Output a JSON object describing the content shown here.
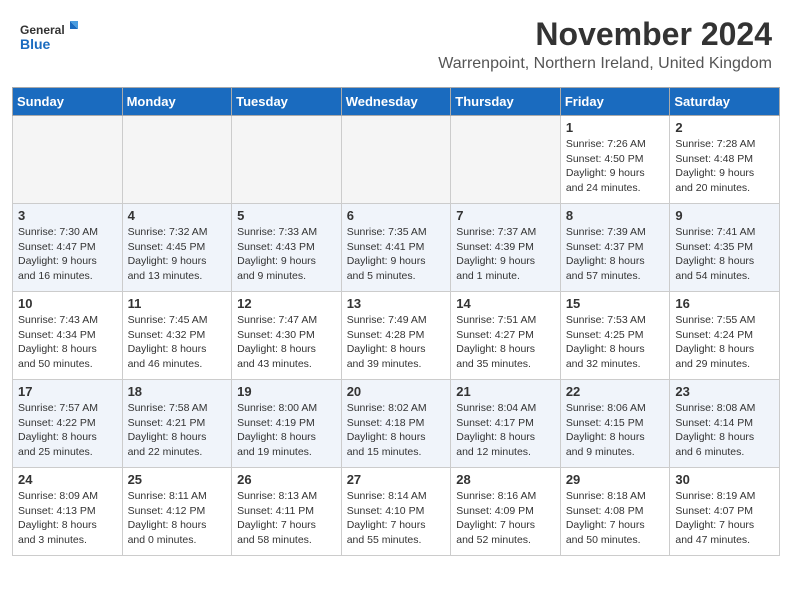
{
  "header": {
    "logo_general": "General",
    "logo_blue": "Blue",
    "title": "November 2024",
    "location": "Warrenpoint, Northern Ireland, United Kingdom"
  },
  "days_of_week": [
    "Sunday",
    "Monday",
    "Tuesday",
    "Wednesday",
    "Thursday",
    "Friday",
    "Saturday"
  ],
  "weeks": [
    [
      {
        "day": "",
        "empty": true
      },
      {
        "day": "",
        "empty": true
      },
      {
        "day": "",
        "empty": true
      },
      {
        "day": "",
        "empty": true
      },
      {
        "day": "",
        "empty": true
      },
      {
        "day": "1",
        "sunrise": "Sunrise: 7:26 AM",
        "sunset": "Sunset: 4:50 PM",
        "daylight": "Daylight: 9 hours and 24 minutes."
      },
      {
        "day": "2",
        "sunrise": "Sunrise: 7:28 AM",
        "sunset": "Sunset: 4:48 PM",
        "daylight": "Daylight: 9 hours and 20 minutes."
      }
    ],
    [
      {
        "day": "3",
        "sunrise": "Sunrise: 7:30 AM",
        "sunset": "Sunset: 4:47 PM",
        "daylight": "Daylight: 9 hours and 16 minutes."
      },
      {
        "day": "4",
        "sunrise": "Sunrise: 7:32 AM",
        "sunset": "Sunset: 4:45 PM",
        "daylight": "Daylight: 9 hours and 13 minutes."
      },
      {
        "day": "5",
        "sunrise": "Sunrise: 7:33 AM",
        "sunset": "Sunset: 4:43 PM",
        "daylight": "Daylight: 9 hours and 9 minutes."
      },
      {
        "day": "6",
        "sunrise": "Sunrise: 7:35 AM",
        "sunset": "Sunset: 4:41 PM",
        "daylight": "Daylight: 9 hours and 5 minutes."
      },
      {
        "day": "7",
        "sunrise": "Sunrise: 7:37 AM",
        "sunset": "Sunset: 4:39 PM",
        "daylight": "Daylight: 9 hours and 1 minute."
      },
      {
        "day": "8",
        "sunrise": "Sunrise: 7:39 AM",
        "sunset": "Sunset: 4:37 PM",
        "daylight": "Daylight: 8 hours and 57 minutes."
      },
      {
        "day": "9",
        "sunrise": "Sunrise: 7:41 AM",
        "sunset": "Sunset: 4:35 PM",
        "daylight": "Daylight: 8 hours and 54 minutes."
      }
    ],
    [
      {
        "day": "10",
        "sunrise": "Sunrise: 7:43 AM",
        "sunset": "Sunset: 4:34 PM",
        "daylight": "Daylight: 8 hours and 50 minutes."
      },
      {
        "day": "11",
        "sunrise": "Sunrise: 7:45 AM",
        "sunset": "Sunset: 4:32 PM",
        "daylight": "Daylight: 8 hours and 46 minutes."
      },
      {
        "day": "12",
        "sunrise": "Sunrise: 7:47 AM",
        "sunset": "Sunset: 4:30 PM",
        "daylight": "Daylight: 8 hours and 43 minutes."
      },
      {
        "day": "13",
        "sunrise": "Sunrise: 7:49 AM",
        "sunset": "Sunset: 4:28 PM",
        "daylight": "Daylight: 8 hours and 39 minutes."
      },
      {
        "day": "14",
        "sunrise": "Sunrise: 7:51 AM",
        "sunset": "Sunset: 4:27 PM",
        "daylight": "Daylight: 8 hours and 35 minutes."
      },
      {
        "day": "15",
        "sunrise": "Sunrise: 7:53 AM",
        "sunset": "Sunset: 4:25 PM",
        "daylight": "Daylight: 8 hours and 32 minutes."
      },
      {
        "day": "16",
        "sunrise": "Sunrise: 7:55 AM",
        "sunset": "Sunset: 4:24 PM",
        "daylight": "Daylight: 8 hours and 29 minutes."
      }
    ],
    [
      {
        "day": "17",
        "sunrise": "Sunrise: 7:57 AM",
        "sunset": "Sunset: 4:22 PM",
        "daylight": "Daylight: 8 hours and 25 minutes."
      },
      {
        "day": "18",
        "sunrise": "Sunrise: 7:58 AM",
        "sunset": "Sunset: 4:21 PM",
        "daylight": "Daylight: 8 hours and 22 minutes."
      },
      {
        "day": "19",
        "sunrise": "Sunrise: 8:00 AM",
        "sunset": "Sunset: 4:19 PM",
        "daylight": "Daylight: 8 hours and 19 minutes."
      },
      {
        "day": "20",
        "sunrise": "Sunrise: 8:02 AM",
        "sunset": "Sunset: 4:18 PM",
        "daylight": "Daylight: 8 hours and 15 minutes."
      },
      {
        "day": "21",
        "sunrise": "Sunrise: 8:04 AM",
        "sunset": "Sunset: 4:17 PM",
        "daylight": "Daylight: 8 hours and 12 minutes."
      },
      {
        "day": "22",
        "sunrise": "Sunrise: 8:06 AM",
        "sunset": "Sunset: 4:15 PM",
        "daylight": "Daylight: 8 hours and 9 minutes."
      },
      {
        "day": "23",
        "sunrise": "Sunrise: 8:08 AM",
        "sunset": "Sunset: 4:14 PM",
        "daylight": "Daylight: 8 hours and 6 minutes."
      }
    ],
    [
      {
        "day": "24",
        "sunrise": "Sunrise: 8:09 AM",
        "sunset": "Sunset: 4:13 PM",
        "daylight": "Daylight: 8 hours and 3 minutes."
      },
      {
        "day": "25",
        "sunrise": "Sunrise: 8:11 AM",
        "sunset": "Sunset: 4:12 PM",
        "daylight": "Daylight: 8 hours and 0 minutes."
      },
      {
        "day": "26",
        "sunrise": "Sunrise: 8:13 AM",
        "sunset": "Sunset: 4:11 PM",
        "daylight": "Daylight: 7 hours and 58 minutes."
      },
      {
        "day": "27",
        "sunrise": "Sunrise: 8:14 AM",
        "sunset": "Sunset: 4:10 PM",
        "daylight": "Daylight: 7 hours and 55 minutes."
      },
      {
        "day": "28",
        "sunrise": "Sunrise: 8:16 AM",
        "sunset": "Sunset: 4:09 PM",
        "daylight": "Daylight: 7 hours and 52 minutes."
      },
      {
        "day": "29",
        "sunrise": "Sunrise: 8:18 AM",
        "sunset": "Sunset: 4:08 PM",
        "daylight": "Daylight: 7 hours and 50 minutes."
      },
      {
        "day": "30",
        "sunrise": "Sunrise: 8:19 AM",
        "sunset": "Sunset: 4:07 PM",
        "daylight": "Daylight: 7 hours and 47 minutes."
      }
    ]
  ]
}
